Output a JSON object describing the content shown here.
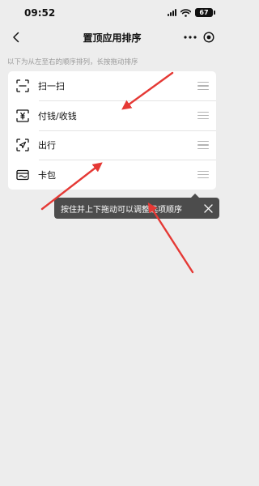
{
  "status_bar": {
    "time": "09:52",
    "battery": "67",
    "icons": [
      "signal-icon",
      "wifi-icon",
      "battery-icon"
    ]
  },
  "nav": {
    "title": "置顶应用排序",
    "back_icon": "chevron-left-icon",
    "more_icon": "more-dots-icon",
    "target_icon": "target-icon"
  },
  "hint": "以下为从左至右的顺序排列，长按拖动排序",
  "items": [
    {
      "label": "扫一扫",
      "icon": "scan-icon"
    },
    {
      "label": "付钱/收钱",
      "icon": "yuan-icon"
    },
    {
      "label": "出行",
      "icon": "navigation-icon"
    },
    {
      "label": "卡包",
      "icon": "card-icon"
    }
  ],
  "tooltip": {
    "text": "按住并上下拖动可以调整选项顺序",
    "close_icon": "close-icon"
  },
  "colors": {
    "background": "#ededed",
    "card": "#ffffff",
    "tooltip": "#4c4c4c",
    "annotation_arrow": "#e53935",
    "hint_text": "#9a9a9a"
  }
}
